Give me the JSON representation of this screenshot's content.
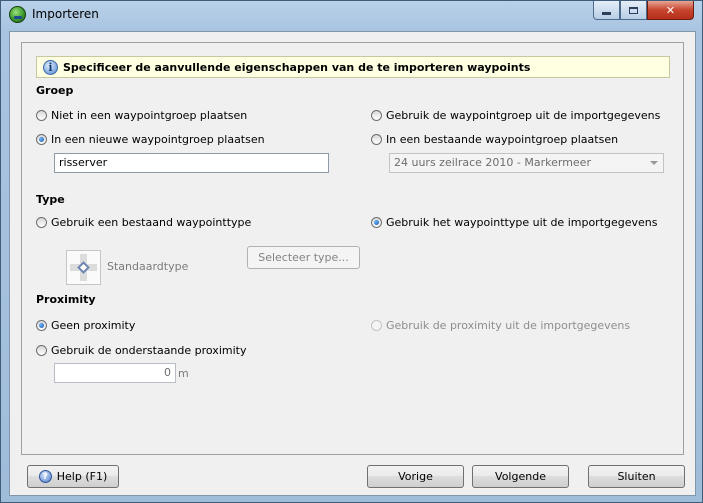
{
  "window": {
    "title": "Importeren",
    "controls": {
      "minimize": "minimize-icon",
      "maximize": "maximize-icon",
      "close": "close-icon"
    }
  },
  "info": {
    "icon": "info-icon",
    "text": "Specificeer de aanvullende eigenschappen van de te importeren waypoints"
  },
  "groep": {
    "title": "Groep",
    "options": {
      "no_group": {
        "label": "Niet in een waypointgroep plaatsen",
        "checked": false
      },
      "from_import": {
        "label": "Gebruik de waypointgroep uit de importgegevens",
        "checked": false
      },
      "new_group": {
        "label": "In een nieuwe waypointgroep plaatsen",
        "checked": true
      },
      "existing_group": {
        "label": "In een bestaande waypointgroep plaatsen",
        "checked": false
      }
    },
    "new_group_name": "risserver",
    "existing_group_selected": "24 uurs zeilrace 2010 - Markermeer"
  },
  "type": {
    "title": "Type",
    "options": {
      "existing_type": {
        "label": "Gebruik een bestaand waypointtype",
        "checked": false
      },
      "import_type": {
        "label": "Gebruik het waypointtype uit de importgegevens",
        "checked": true
      }
    },
    "standard_type_label": "Standaardtype",
    "select_type_button": "Selecteer type..."
  },
  "proximity": {
    "title": "Proximity",
    "options": {
      "none": {
        "label": "Geen proximity",
        "checked": true
      },
      "from_import": {
        "label": "Gebruik de proximity uit de importgegevens",
        "checked": false,
        "disabled": true
      },
      "custom": {
        "label": "Gebruik de onderstaande proximity",
        "checked": false
      }
    },
    "value": "0",
    "unit": "m"
  },
  "footer": {
    "help_label": "Help (F1)",
    "prev_label": "Vorige",
    "next_label": "Volgende",
    "close_label": "Sluiten"
  }
}
